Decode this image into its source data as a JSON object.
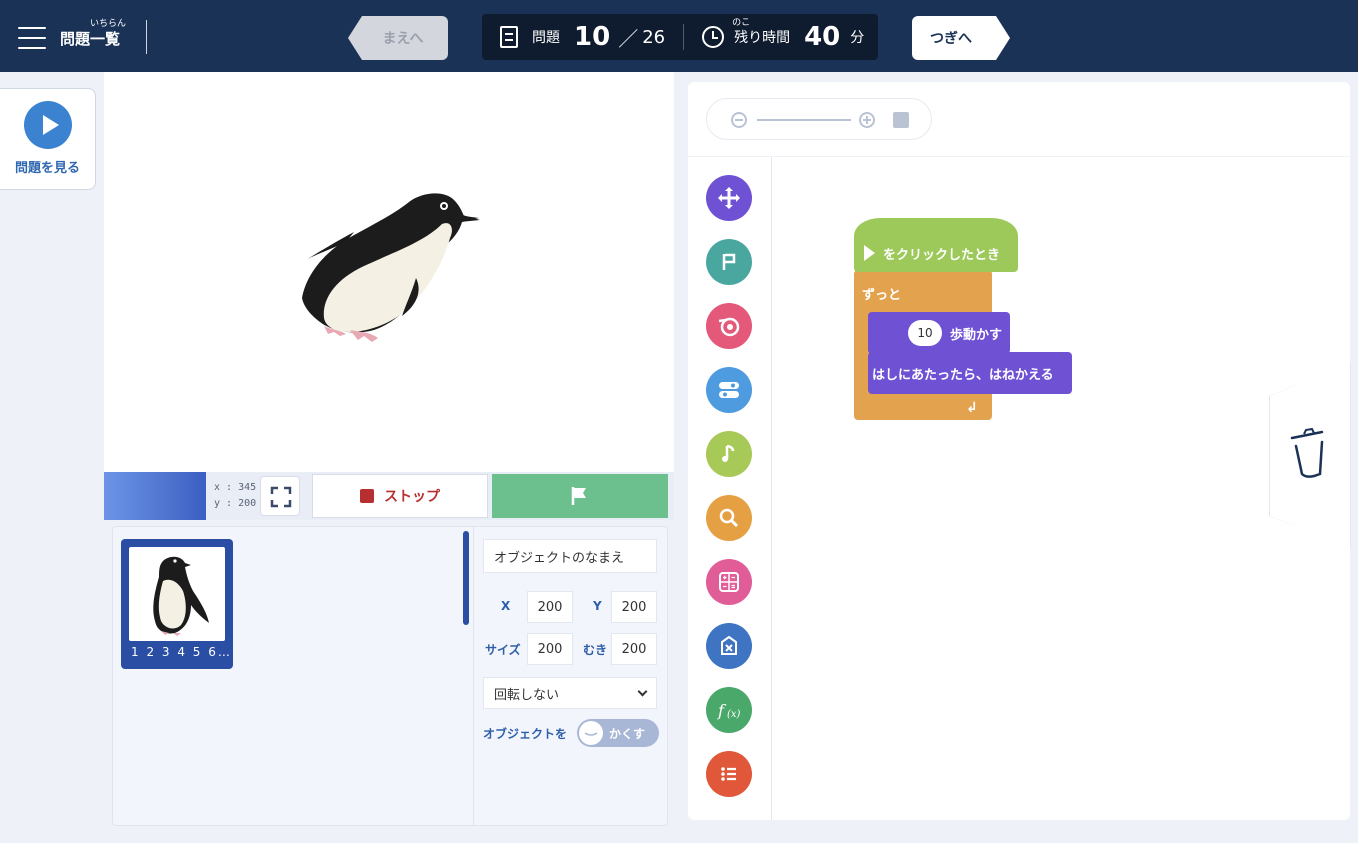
{
  "header": {
    "menu_label": "問題一覧",
    "menu_ruby": "いちらん",
    "prev_label": "まえへ",
    "problem_label": "問題",
    "problem_current": "10",
    "problem_slash": "／",
    "problem_total": "26",
    "time_ruby": "のこ",
    "time_label": "残り時間",
    "time_value": "40",
    "time_unit": "分",
    "next_label": "つぎへ"
  },
  "rail": {
    "view_problem_label": "問題を見る"
  },
  "stage": {
    "coord_x": "x : 345",
    "coord_y": "y : 200",
    "stop_label": "ストップ",
    "swatch_color": "#4b73d8"
  },
  "sprite": {
    "name": "1 2 3 4 5 6…",
    "name_placeholder": "オブジェクトのなまえ",
    "x_label": "X",
    "x_value": "200",
    "y_label": "Y",
    "y_value": "200",
    "size_label": "サイズ",
    "size_value": "200",
    "dir_label": "むき",
    "dir_value": "200",
    "rotation_value": "回転しない",
    "visibility_label": "オブジェクトを",
    "visibility_toggle": "かくす"
  },
  "palette": [
    {
      "name": "motion",
      "color": "#6f52d4",
      "icon": "move-arrows-icon"
    },
    {
      "name": "start",
      "color": "#4aa7a0",
      "icon": "flag-icon"
    },
    {
      "name": "looks",
      "color": "#e4587a",
      "icon": "eye-icon"
    },
    {
      "name": "control",
      "color": "#4f9be0",
      "icon": "toggle-icon"
    },
    {
      "name": "sound",
      "color": "#a7c957",
      "icon": "music-note-icon"
    },
    {
      "name": "sensing",
      "color": "#e6a044",
      "icon": "magnifier-icon"
    },
    {
      "name": "operators",
      "color": "#e05d97",
      "icon": "calculator-icon"
    },
    {
      "name": "variables",
      "color": "#3f74c2",
      "icon": "variable-icon"
    },
    {
      "name": "functions",
      "color": "#4aa86a",
      "icon": "function-icon"
    },
    {
      "name": "lists",
      "color": "#e0573a",
      "icon": "list-icon"
    }
  ],
  "blocks": {
    "hat_label": "をクリックしたとき",
    "forever_label": "ずっと",
    "move_value": "10",
    "move_label": "歩動かす",
    "bounce_label": "はしにあたったら、はねかえる",
    "forever_end": "↲"
  }
}
